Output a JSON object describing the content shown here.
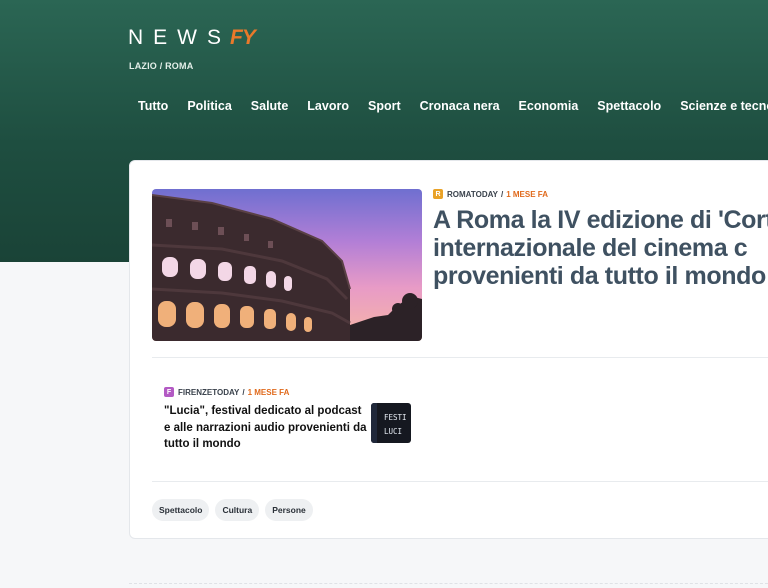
{
  "brand": {
    "news": "NEWS",
    "fy": "FY",
    "region": "LAZIO / ROMA",
    "accent": "#e9792a",
    "hero_color": "#2b6654"
  },
  "nav": [
    "Tutto",
    "Politica",
    "Salute",
    "Lavoro",
    "Sport",
    "Cronaca nera",
    "Economia",
    "Spettacolo",
    "Scienze e tecnologia"
  ],
  "feature": {
    "source": "ROMATODAY",
    "source_icon": "R",
    "source_color": "#e9a227",
    "separator": "/",
    "time": "1 MESE FA",
    "title": "A Roma la IV edizione di 'Corto internazionale del cinema c provenienti da tutto il mondo",
    "image": "colosseum-sunset"
  },
  "secondary": {
    "source": "FIRENZETODAY",
    "source_icon": "F",
    "source_color": "#b35ac4",
    "separator": "/",
    "time": "1 MESE FA",
    "title": "\"Lucia\", festival dedicato al podcast e alle narrazioni audio provenienti da tutto il mondo",
    "thumb_text": [
      "FESTI",
      "LUCI"
    ]
  },
  "tags": [
    "Spettacolo",
    "Cultura",
    "Persone"
  ]
}
